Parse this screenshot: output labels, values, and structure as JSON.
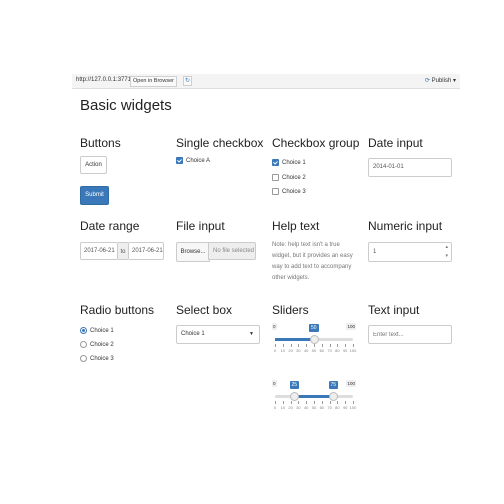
{
  "browser": {
    "url": "http://127.0.0.1:3771",
    "open_label": "Open in Browser",
    "refresh_glyph": "↻",
    "publish_label": "Publish",
    "publish_icon": "publish-icon"
  },
  "page": {
    "title": "Basic widgets"
  },
  "buttons": {
    "heading": "Buttons",
    "action": "Action",
    "submit": "Submit"
  },
  "single_checkbox": {
    "heading": "Single checkbox",
    "label": "Choice A",
    "checked": true
  },
  "checkbox_group": {
    "heading": "Checkbox group",
    "options": [
      {
        "label": "Choice 1",
        "checked": true
      },
      {
        "label": "Choice 2",
        "checked": false
      },
      {
        "label": "Choice 3",
        "checked": false
      }
    ]
  },
  "date_input": {
    "heading": "Date input",
    "value": "2014-01-01"
  },
  "date_range": {
    "heading": "Date range",
    "start": "2017-06-21",
    "separator": "to",
    "end": "2017-06-21"
  },
  "file_input": {
    "heading": "File input",
    "browse": "Browse...",
    "placeholder": "No file selected"
  },
  "help_text": {
    "heading": "Help text",
    "text": "Note: help text isn't a true widget, but it provides an easy way to add text to accompany other widgets."
  },
  "numeric_input": {
    "heading": "Numeric input",
    "value": "1"
  },
  "radio_buttons": {
    "heading": "Radio buttons",
    "options": [
      {
        "label": "Choice 1",
        "checked": true
      },
      {
        "label": "Choice 2",
        "checked": false
      },
      {
        "label": "Choice 3",
        "checked": false
      }
    ]
  },
  "select_box": {
    "heading": "Select box",
    "selected": "Choice 1"
  },
  "sliders": {
    "heading": "Sliders",
    "slider1": {
      "min": "0",
      "max": "100",
      "value": "50",
      "min_value": 0,
      "max_value": 100,
      "current": 50
    },
    "slider2": {
      "min": "0",
      "max": "100",
      "low": "25",
      "high": "75",
      "min_value": 0,
      "max_value": 100,
      "low_value": 25,
      "high_value": 75
    },
    "tick_labels": [
      "0",
      "10",
      "20",
      "30",
      "40",
      "50",
      "60",
      "70",
      "80",
      "90",
      "100"
    ]
  },
  "text_input": {
    "heading": "Text input",
    "placeholder": "Enter text..."
  },
  "colors": {
    "accent": "#3a78b9",
    "border": "#cccccc"
  }
}
